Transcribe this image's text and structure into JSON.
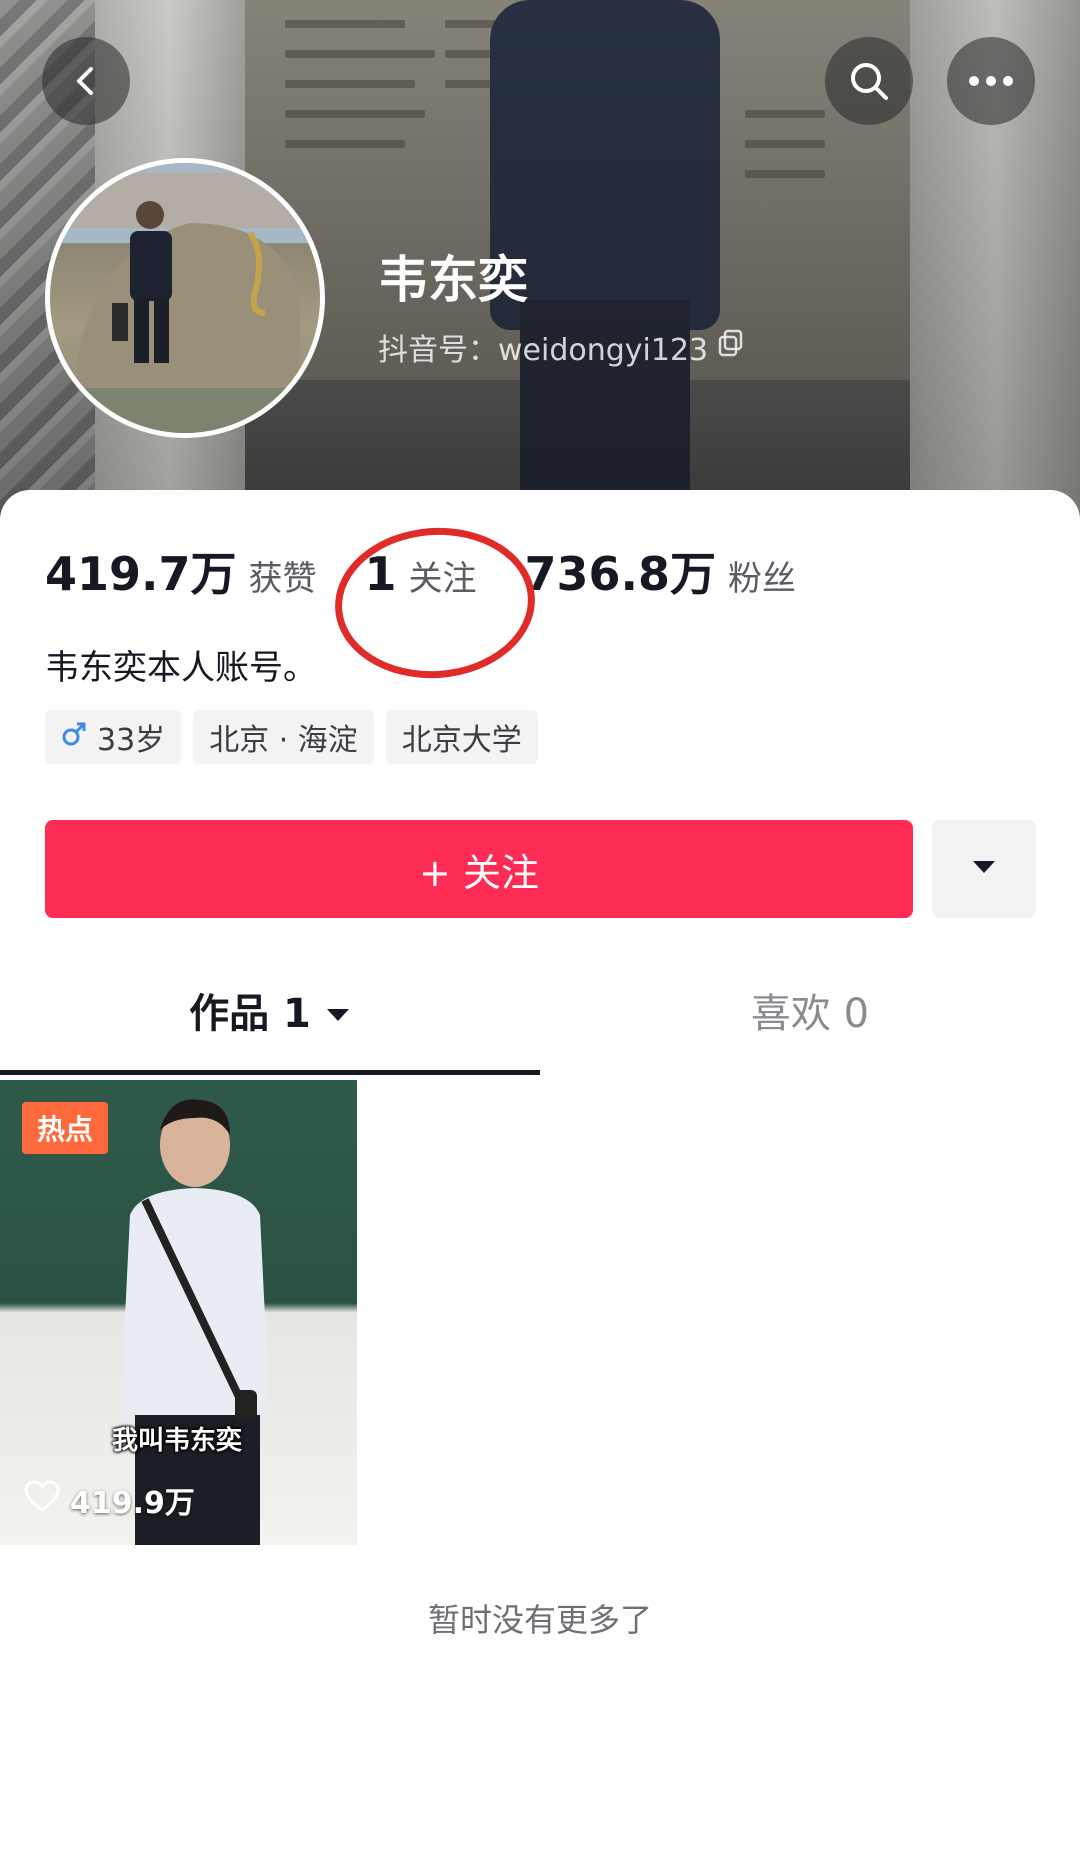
{
  "profile": {
    "nickname": "韦东奕",
    "douyin_id": "抖音号：weidongyi123",
    "bio": "韦东奕本人账号。"
  },
  "stats": {
    "likes_count": "419.7万",
    "likes_label": "获赞",
    "following_count": "1",
    "following_label": "关注",
    "followers_count": "736.8万",
    "followers_label": "粉丝"
  },
  "tags": {
    "age": "33岁",
    "location": "北京 · 海淀",
    "school": "北京大学"
  },
  "actions": {
    "follow_label": "+ 关注"
  },
  "tabs": {
    "works": "作品 1",
    "likes": "喜欢 0"
  },
  "video": {
    "badge": "热点",
    "caption": "我叫韦东奕",
    "like_count": "419.9万"
  },
  "footer": {
    "end_note": "暂时没有更多了"
  },
  "colors": {
    "accent": "#fe2c55",
    "annotation_circle": "#e02b2b",
    "hot_badge": "#ff6a3d"
  },
  "icons": [
    "back-icon",
    "search-icon",
    "more-icon",
    "copy-icon",
    "male-icon",
    "dropdown-icon",
    "caret-down-icon",
    "heart-icon"
  ]
}
